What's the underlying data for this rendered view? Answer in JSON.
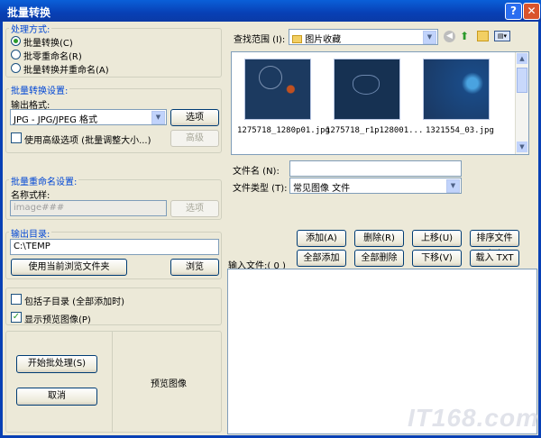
{
  "window": {
    "title": "批量转换",
    "help": "?",
    "close": "✕"
  },
  "process": {
    "legend": "处理方式:",
    "options": [
      {
        "label": "批量转换(C)",
        "selected": true
      },
      {
        "label": "批零重命名(R)",
        "selected": false
      },
      {
        "label": "批量转换并重命名(A)",
        "selected": false
      }
    ]
  },
  "convert": {
    "legend": "批量转换设置:",
    "format_label": "输出格式:",
    "format_value": "JPG - JPG/JPEG 格式",
    "options_button": "选项",
    "advanced_checkbox": "使用高级选项 (批量调整大小...)",
    "advanced_button": "高级"
  },
  "rename": {
    "legend": "批量重命名设置:",
    "pattern_label": "名称式样:",
    "pattern_value": "image###",
    "options_button": "选项"
  },
  "output": {
    "legend": "输出目录:",
    "path": "C:\\TEMP",
    "use_current_button": "使用当前浏览文件夹",
    "browse_button": "浏览"
  },
  "checks": {
    "include_subdirs": "包括子目录 (全部添加时)",
    "include_subdirs_checked": false,
    "show_preview": "显示预览图像(P)",
    "show_preview_checked": true
  },
  "actions": {
    "start": "开始批处理(S)",
    "cancel": "取消"
  },
  "preview": {
    "label": "预览图像"
  },
  "browser": {
    "lookin_label": "查找范围 (I):",
    "lookin_value": "图片收藏",
    "thumbnails": [
      {
        "name": "1275718_1280p01.jpg"
      },
      {
        "name": "1275718_r1p128001..."
      },
      {
        "name": "1321554_03.jpg"
      }
    ],
    "filename_label": "文件名 (N):",
    "filename_value": "",
    "filetype_label": "文件类型 (T):",
    "filetype_value": "常见图像 文件"
  },
  "list_buttons": {
    "add": "添加(A)",
    "remove": "删除(R)",
    "up": "上移(U)",
    "sort": "排序文件(O)",
    "add_all": "全部添加(D)",
    "remove_all": "全部删除(E)",
    "down": "下移(V)",
    "load_txt": "载入 TXT"
  },
  "input_files": {
    "label": "输入文件:( 0 )"
  },
  "watermark": {
    "text": "IT168.com"
  },
  "colors": {
    "title_bar": "#0a4fc8",
    "legend": "#0046d5",
    "face": "#ece9d8"
  }
}
